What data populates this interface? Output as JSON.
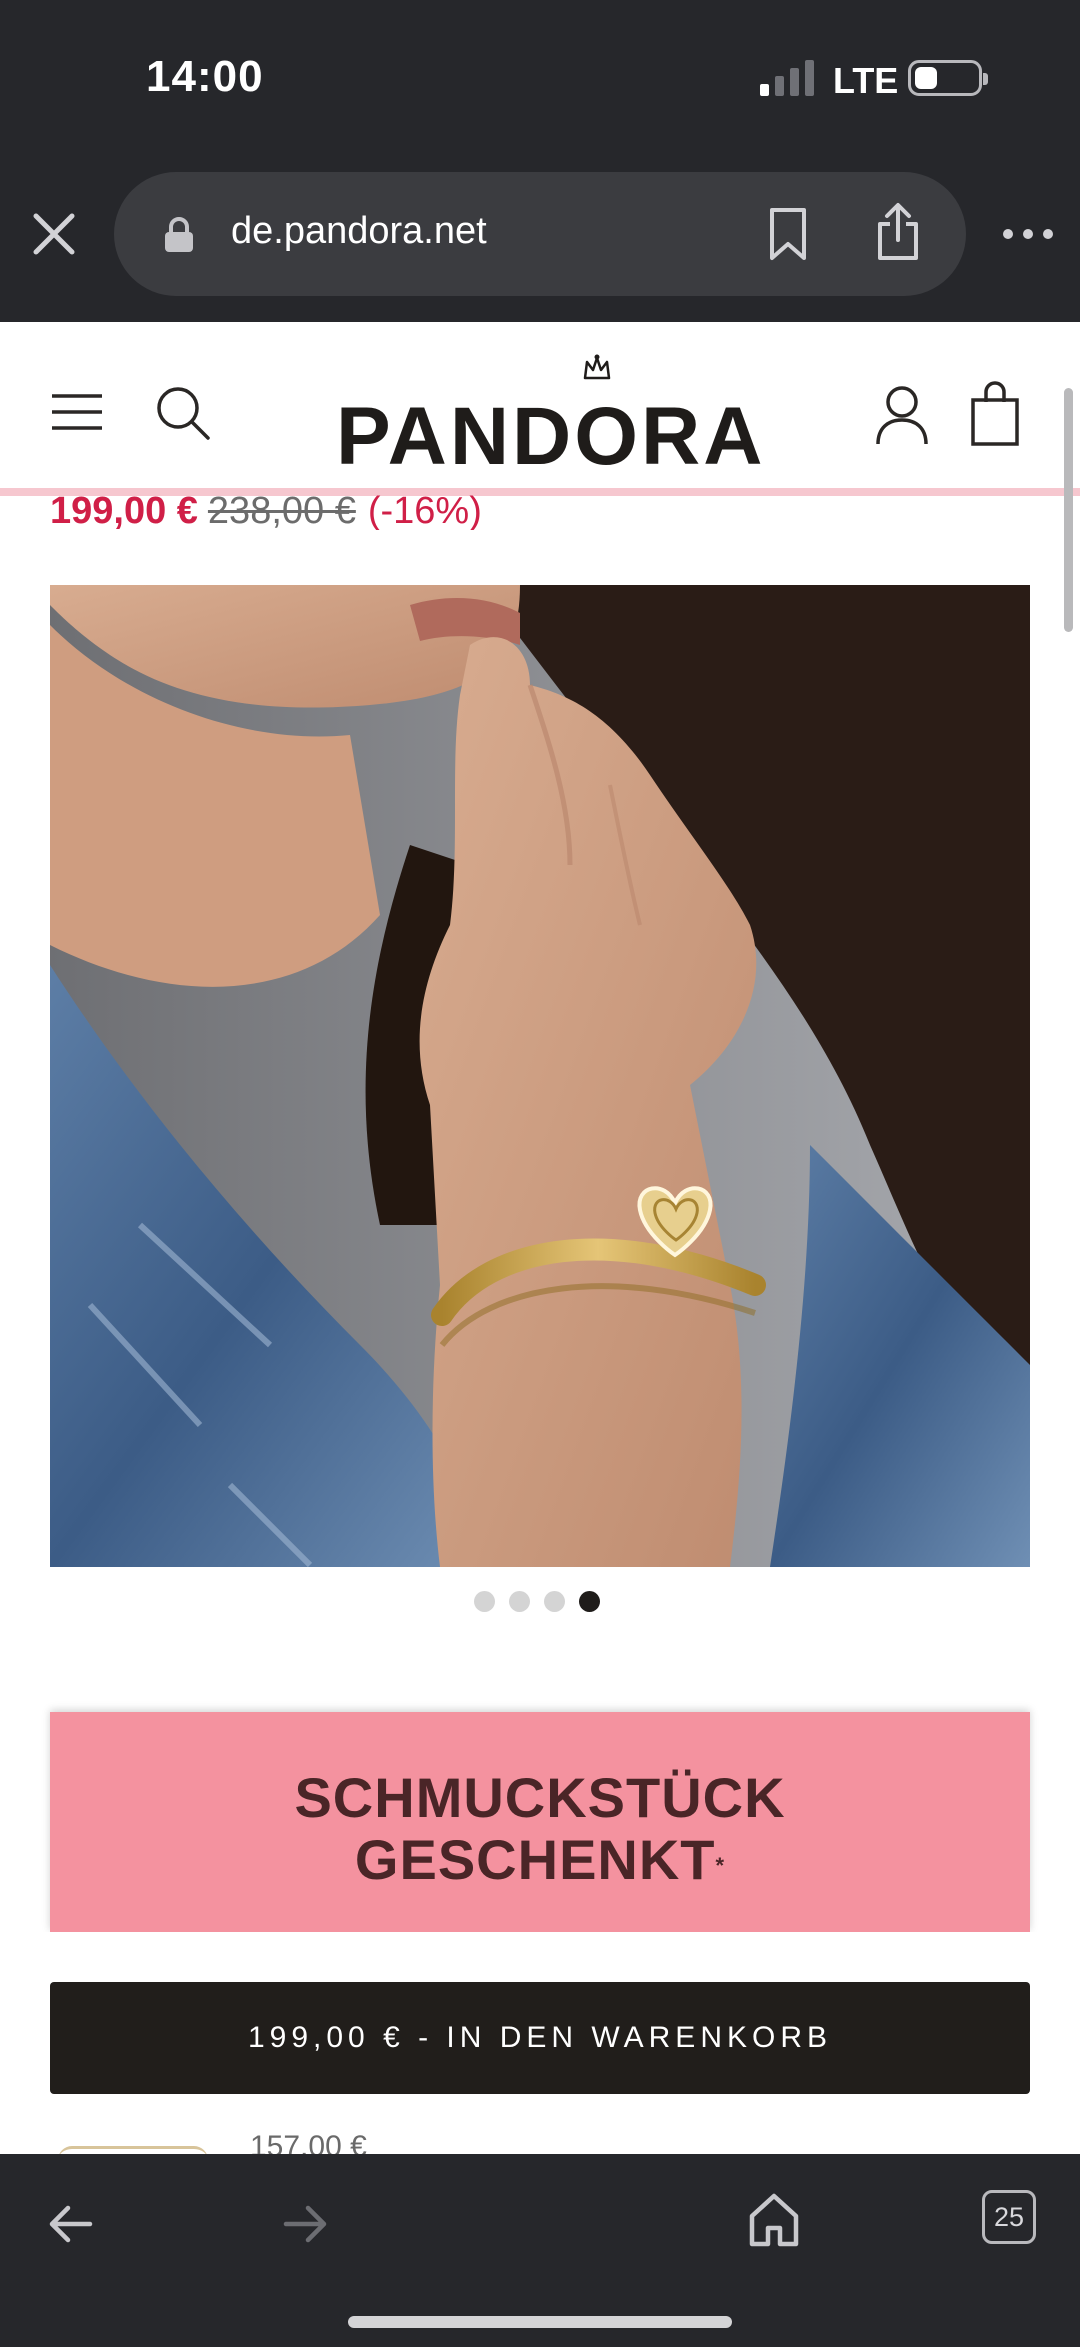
{
  "status_bar": {
    "time": "14:00",
    "network": "LTE",
    "signal_bars_active": 1,
    "signal_bars_total": 4
  },
  "browser": {
    "url": "de.pandora.net",
    "icons": [
      "close-icon",
      "lock-icon",
      "bookmark-icon",
      "share-icon",
      "more-icon"
    ]
  },
  "header": {
    "logo_text": "PANDORA",
    "icons": [
      "menu-icon",
      "search-icon",
      "crown-icon",
      "account-icon",
      "bag-icon"
    ]
  },
  "product": {
    "price_sale": "199,00 €",
    "price_original": "238,00 €",
    "discount": "(-16%)",
    "carousel": {
      "total": 4,
      "active_index": 3
    }
  },
  "promo": {
    "line1": "SCHMUCKSTÜCK",
    "line2": "GESCHENKT",
    "footnote_mark": "*"
  },
  "cart": {
    "button_label": "199,00 € - IN DEN WARENKORB",
    "next_item_price_partial": "157,00 €"
  },
  "bottom_toolbar": {
    "tab_count": "25",
    "icons": [
      "back-icon",
      "forward-icon",
      "home-icon",
      "tabs-icon"
    ]
  },
  "colors": {
    "chrome_bg": "#26272b",
    "sale_red": "#d01f47",
    "promo_pink": "#f4929f",
    "button_dark": "#211e1b",
    "header_accent_line": "#f6c7cf"
  }
}
